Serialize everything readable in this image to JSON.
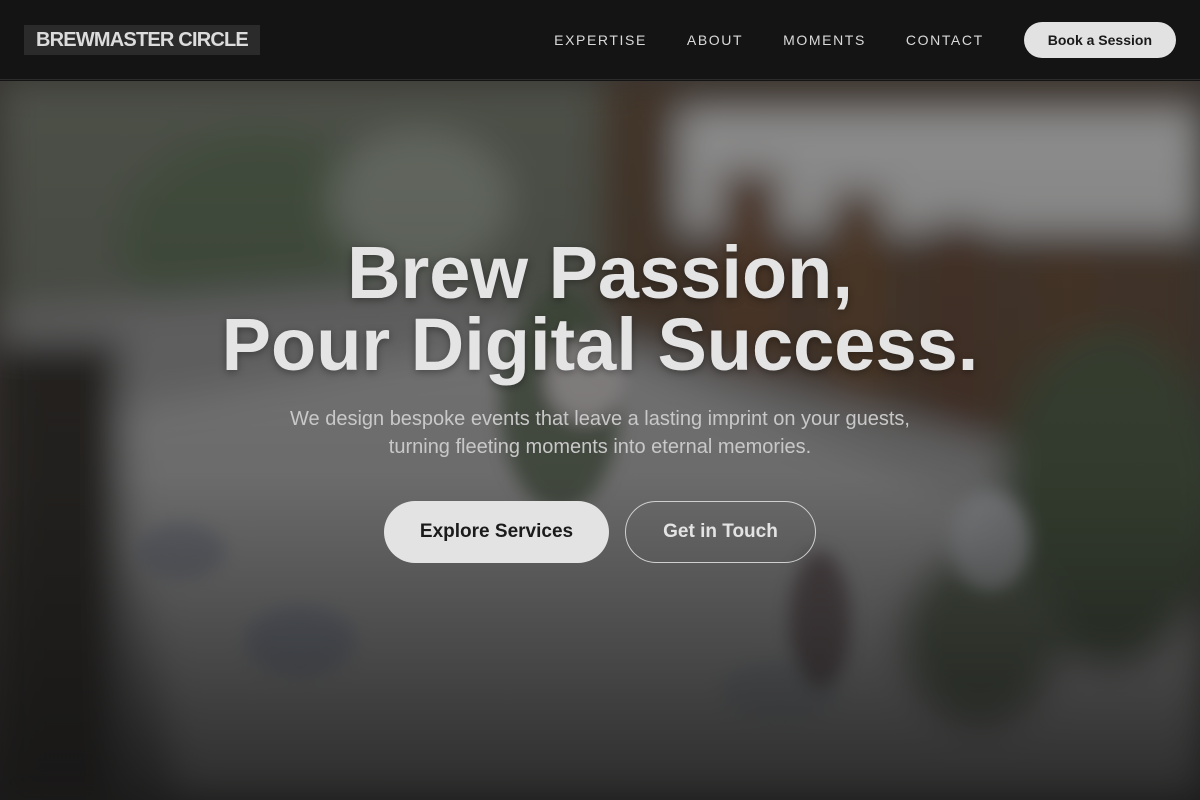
{
  "header": {
    "logo": "BREWMASTER CIRCLE",
    "nav": [
      {
        "label": "EXPERTISE"
      },
      {
        "label": "ABOUT"
      },
      {
        "label": "MOMENTS"
      },
      {
        "label": "CONTACT"
      }
    ],
    "cta_label": "Book a Session"
  },
  "hero": {
    "headline_line1": "Brew Passion,",
    "headline_line2": "Pour Digital Success.",
    "subtext_line1": "We design bespoke events that leave a lasting imprint on your guests,",
    "subtext_line2": "turning fleeting moments into eternal memories.",
    "primary_cta": "Explore Services",
    "secondary_cta": "Get in Touch"
  },
  "colors": {
    "header_bg": "#141414",
    "button_light": "#e3e3e3",
    "text_light": "#e4e4e4"
  }
}
